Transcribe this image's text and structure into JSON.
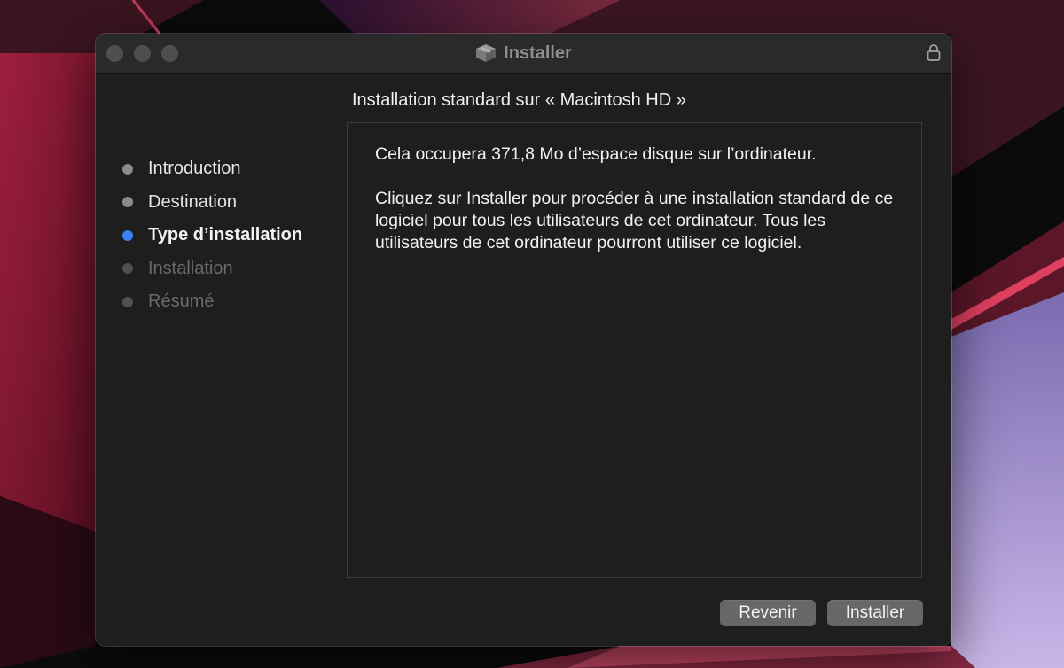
{
  "window": {
    "title": "Installer",
    "app_icon": "installer-box-icon",
    "lock_icon": "lock-icon"
  },
  "steps": [
    {
      "label": "Introduction",
      "state": "done"
    },
    {
      "label": "Destination",
      "state": "done"
    },
    {
      "label": "Type d’installation",
      "state": "current"
    },
    {
      "label": "Installation",
      "state": "future"
    },
    {
      "label": "Résumé",
      "state": "future"
    }
  ],
  "content": {
    "heading": "Installation standard sur « Macintosh HD »",
    "paragraph1": "Cela occupera 371,8 Mo d’espace disque sur l’ordinateur.",
    "paragraph2": "Cliquez sur Installer pour procéder à une installation standard de ce logiciel pour tous les utilisateurs de cet ordinateur. Tous les utilisateurs de cet ordinateur pourront utiliser ce logiciel."
  },
  "buttons": {
    "back_label": "Revenir",
    "install_label": "Installer"
  },
  "colors": {
    "accent": "#3b82f6",
    "window_bg": "#1e1e1e",
    "button_bg": "#676767"
  }
}
